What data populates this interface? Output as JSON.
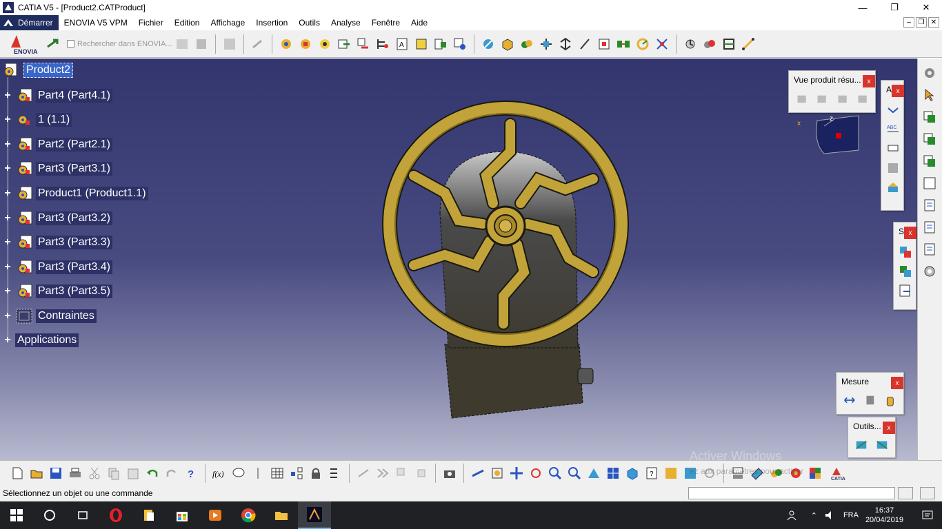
{
  "window": {
    "title": "CATIA V5 - [Product2.CATProduct]",
    "min": "—",
    "max": "❐",
    "close": "✕"
  },
  "menu": {
    "start": "Démarrer",
    "items": [
      "ENOVIA V5 VPM",
      "Fichier",
      "Edition",
      "Affichage",
      "Insertion",
      "Outils",
      "Analyse",
      "Fenêtre",
      "Aide"
    ],
    "mdi": [
      "–",
      "❐",
      "✕"
    ]
  },
  "toolbar": {
    "search_placeholder": "Rechercher dans ENOVIA..."
  },
  "tree": {
    "root": "Product2",
    "children": [
      "Part4 (Part4.1)",
      "1 (1.1)",
      "Part2 (Part2.1)",
      "Part3 (Part3.1)",
      "Product1 (Product1.1)",
      "Part3 (Part3.2)",
      "Part3 (Part3.3)",
      "Part3 (Part3.4)",
      "Part3 (Part3.5)",
      "Contraintes",
      "Applications"
    ]
  },
  "palettes": {
    "vue_produit": "Vue produit résu...",
    "annot": "A",
    "s": "S",
    "mesure": "Mesure",
    "outils": "Outils...",
    "close": "x"
  },
  "compass": {
    "x": "x",
    "z": "z"
  },
  "statusbar": {
    "message": "Sélectionnez un objet ou une commande",
    "watermark_line1": "Activer Windows",
    "watermark_line2": "ez aux paramètres pour activer"
  },
  "taskbar": {
    "lang": "FRA",
    "time": "16:37",
    "date": "20/04/2019"
  },
  "colors": {
    "viewport_top": "#33366e",
    "wheel": "#c2a33a",
    "body": "#4a4738",
    "accent": "#d9342b"
  }
}
